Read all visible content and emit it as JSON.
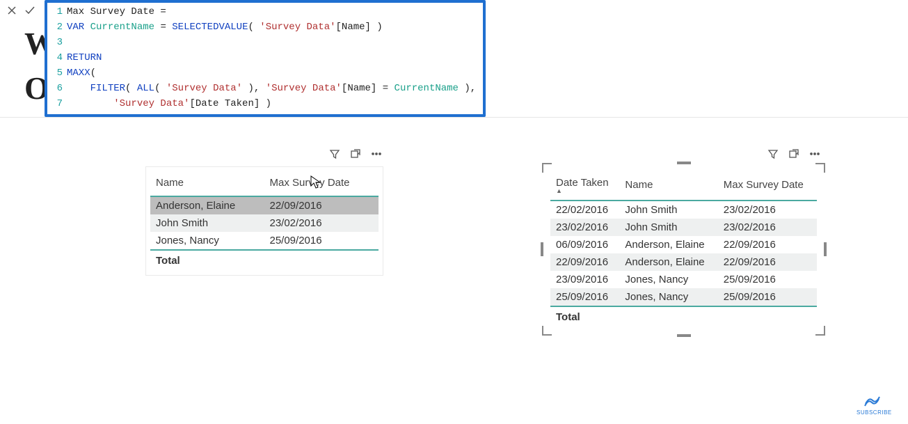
{
  "bg_title": {
    "line1": "Wo",
    "line2": "Oc"
  },
  "formula": {
    "lines": [
      {
        "n": 1,
        "segs": [
          {
            "c": "txt",
            "t": "Max Survey Date ="
          }
        ]
      },
      {
        "n": 2,
        "segs": [
          {
            "c": "kw",
            "t": "VAR"
          },
          {
            "c": "txt",
            "t": " "
          },
          {
            "c": "id",
            "t": "CurrentName"
          },
          {
            "c": "txt",
            "t": " = "
          },
          {
            "c": "fn",
            "t": "SELECTEDVALUE"
          },
          {
            "c": "txt",
            "t": "( "
          },
          {
            "c": "str",
            "t": "'Survey Data'"
          },
          {
            "c": "txt",
            "t": "[Name] )"
          }
        ]
      },
      {
        "n": 3,
        "segs": []
      },
      {
        "n": 4,
        "segs": [
          {
            "c": "kw",
            "t": "RETURN"
          }
        ]
      },
      {
        "n": 5,
        "segs": [
          {
            "c": "fn",
            "t": "MAXX"
          },
          {
            "c": "txt",
            "t": "("
          }
        ]
      },
      {
        "n": 6,
        "segs": [
          {
            "c": "txt",
            "t": "    "
          },
          {
            "c": "fn",
            "t": "FILTER"
          },
          {
            "c": "txt",
            "t": "( "
          },
          {
            "c": "fn",
            "t": "ALL"
          },
          {
            "c": "txt",
            "t": "( "
          },
          {
            "c": "str",
            "t": "'Survey Data'"
          },
          {
            "c": "txt",
            "t": " ), "
          },
          {
            "c": "str",
            "t": "'Survey Data'"
          },
          {
            "c": "txt",
            "t": "[Name] = "
          },
          {
            "c": "id",
            "t": "CurrentName"
          },
          {
            "c": "txt",
            "t": " ),"
          }
        ]
      },
      {
        "n": 7,
        "segs": [
          {
            "c": "txt",
            "t": "        "
          },
          {
            "c": "str",
            "t": "'Survey Data'"
          },
          {
            "c": "txt",
            "t": "[Date Taken] )"
          }
        ]
      }
    ]
  },
  "viz_left": {
    "headers": [
      "Name",
      "Max Survey Date"
    ],
    "rows": [
      {
        "cells": [
          "Anderson, Elaine",
          "22/09/2016"
        ],
        "hl": true
      },
      {
        "cells": [
          "John Smith",
          "23/02/2016"
        ],
        "hl": false
      },
      {
        "cells": [
          "Jones, Nancy",
          "25/09/2016"
        ],
        "hl": false
      }
    ],
    "total_label": "Total"
  },
  "viz_right": {
    "headers": [
      "Date Taken",
      "Name",
      "Max Survey Date"
    ],
    "sorted_col": 0,
    "rows": [
      {
        "cells": [
          "22/02/2016",
          "John Smith",
          "23/02/2016"
        ]
      },
      {
        "cells": [
          "23/02/2016",
          "John Smith",
          "23/02/2016"
        ]
      },
      {
        "cells": [
          "06/09/2016",
          "Anderson, Elaine",
          "22/09/2016"
        ]
      },
      {
        "cells": [
          "22/09/2016",
          "Anderson, Elaine",
          "22/09/2016"
        ]
      },
      {
        "cells": [
          "23/09/2016",
          "Jones, Nancy",
          "25/09/2016"
        ]
      },
      {
        "cells": [
          "25/09/2016",
          "Jones, Nancy",
          "25/09/2016"
        ]
      }
    ],
    "total_label": "Total"
  },
  "subscribe_label": "SUBSCRIBE"
}
